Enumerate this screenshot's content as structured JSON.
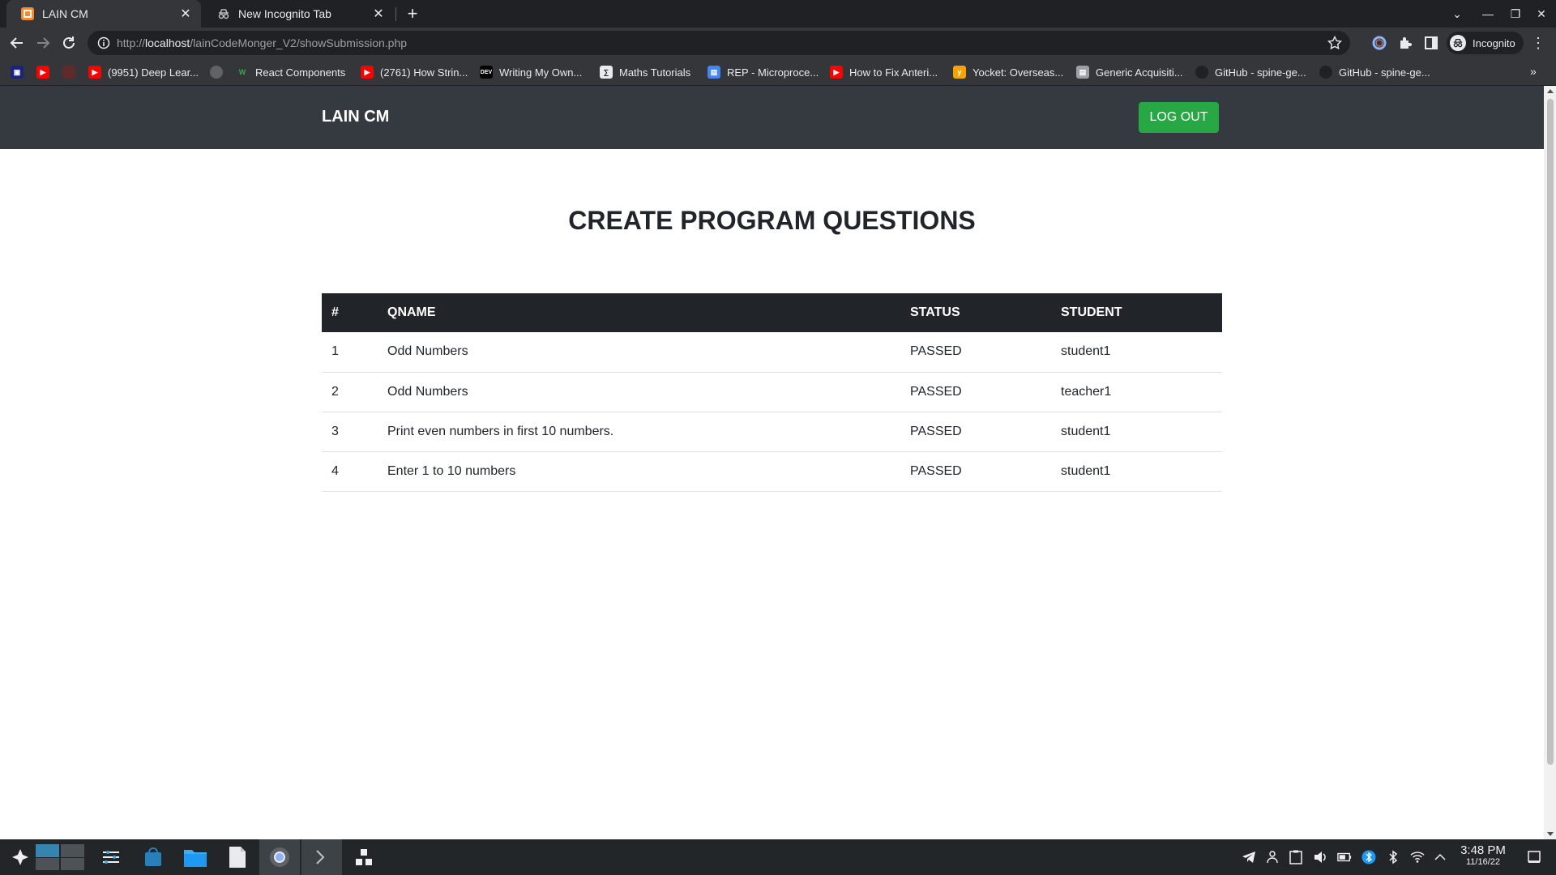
{
  "browser": {
    "tabs": [
      {
        "title": "LAIN CM",
        "active": true
      },
      {
        "title": "New Incognito Tab",
        "active": false
      }
    ],
    "address": {
      "scheme": "http://",
      "host": "localhost",
      "path": "/lainCodeMonger_V2/showSubmission.php"
    },
    "profile_label": "Incognito",
    "bookmarks": [
      {
        "label": "",
        "icon": "dev-tools-icon"
      },
      {
        "label": "",
        "icon": "youtube-icon"
      },
      {
        "label": "",
        "icon": "bookmark-icon"
      },
      {
        "label": "(9951) Deep Lear...",
        "icon": "youtube-icon"
      },
      {
        "label": "",
        "icon": "globe-icon"
      },
      {
        "label": "React Components",
        "icon": "w-icon"
      },
      {
        "label": "(2761) How Strin...",
        "icon": "youtube-icon"
      },
      {
        "label": "Writing My Own...",
        "icon": "dev-icon"
      },
      {
        "label": "Maths Tutorials",
        "icon": "math-icon"
      },
      {
        "label": "REP - Microproce...",
        "icon": "doc-icon"
      },
      {
        "label": "How to Fix Anteri...",
        "icon": "youtube-icon"
      },
      {
        "label": "Yocket: Overseas...",
        "icon": "yocket-icon"
      },
      {
        "label": "Generic Acquisiti...",
        "icon": "doc-icon"
      },
      {
        "label": "GitHub - spine-ge...",
        "icon": "github-icon"
      },
      {
        "label": "GitHub - spine-ge...",
        "icon": "github-icon"
      }
    ]
  },
  "app": {
    "brand": "LAIN CM",
    "logout_label": "LOG OUT",
    "logout_color": "#28a745",
    "navbar_color": "#343a40",
    "page_title": "CREATE PROGRAM QUESTIONS",
    "table": {
      "headers": [
        "#",
        "QNAME",
        "STATUS",
        "STUDENT"
      ],
      "rows": [
        {
          "num": "1",
          "qname": "Odd Numbers",
          "status": "PASSED",
          "student": "student1"
        },
        {
          "num": "2",
          "qname": "Odd Numbers",
          "status": "PASSED",
          "student": "teacher1"
        },
        {
          "num": "3",
          "qname": "Print even numbers in first 10 numbers.",
          "status": "PASSED",
          "student": "student1"
        },
        {
          "num": "4",
          "qname": "Enter 1 to 10 numbers",
          "status": "PASSED",
          "student": "student1"
        }
      ]
    }
  },
  "taskbar": {
    "time": "3:48 PM",
    "date": "11/16/22"
  }
}
